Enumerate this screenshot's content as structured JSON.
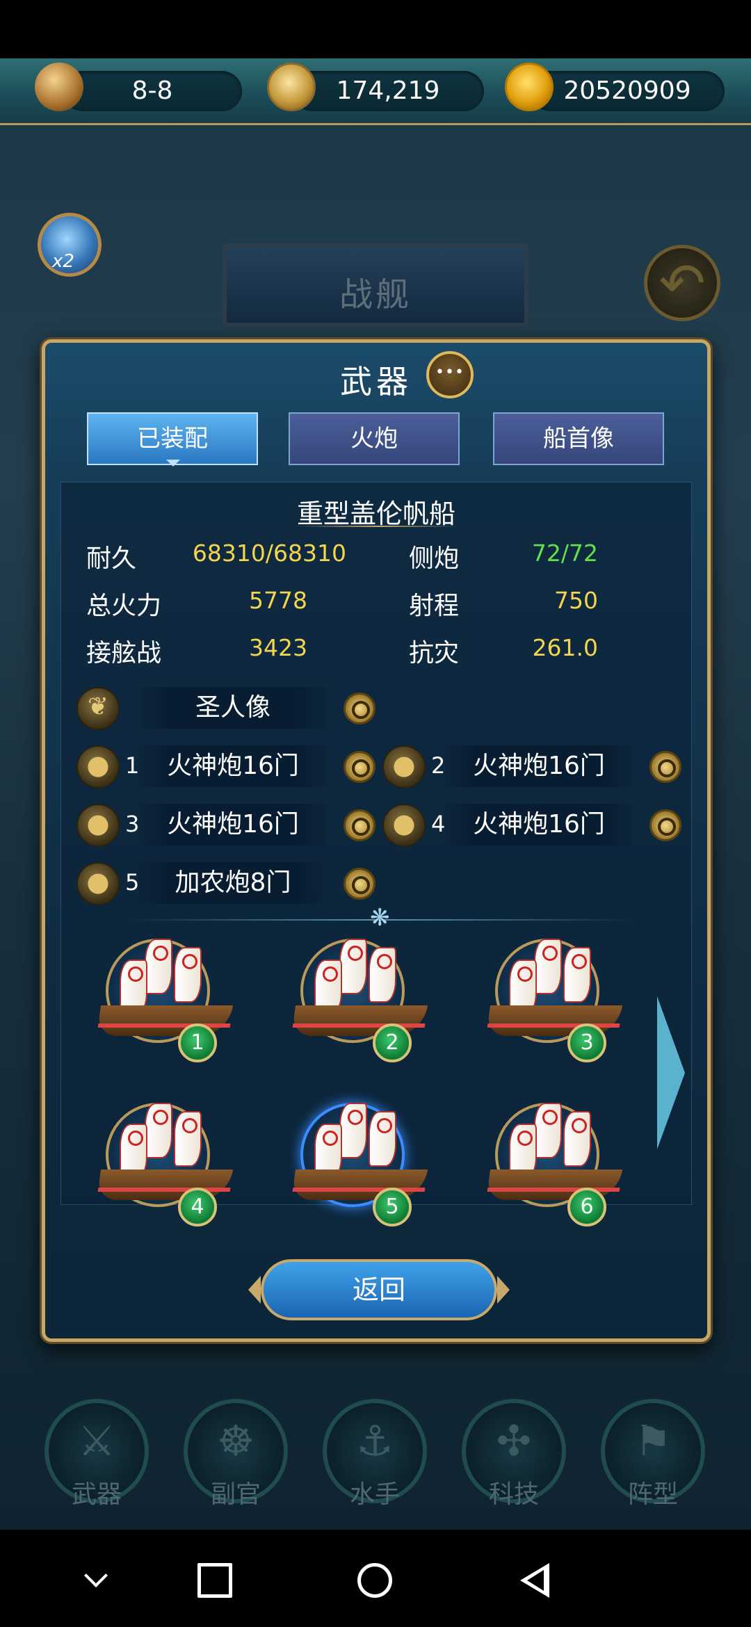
{
  "resources": {
    "stage": "8-8",
    "silver": "174,219",
    "gold": "20520909"
  },
  "scene": {
    "title": "战舰",
    "zoom_label": "x2"
  },
  "panel": {
    "title": "武器",
    "tabs": [
      {
        "label": "已装配",
        "active": true
      },
      {
        "label": "火炮",
        "active": false
      },
      {
        "label": "船首像",
        "active": false
      }
    ],
    "ship_name": "重型盖伦帆船",
    "stats": [
      {
        "label": "耐久",
        "value": "68310/68310"
      },
      {
        "label": "侧炮",
        "value": "72/72"
      },
      {
        "label": "总火力",
        "value": "5778"
      },
      {
        "label": "射程",
        "value": "750"
      },
      {
        "label": "接舷战",
        "value": "3423"
      },
      {
        "label": "抗灾",
        "value": "261.0"
      }
    ],
    "figurehead": {
      "name": "圣人像"
    },
    "cannons": [
      {
        "num": "1",
        "name": "火神炮16门"
      },
      {
        "num": "2",
        "name": "火神炮16门"
      },
      {
        "num": "3",
        "name": "火神炮16门"
      },
      {
        "num": "4",
        "name": "火神炮16门"
      },
      {
        "num": "5",
        "name": "加农炮8门"
      }
    ],
    "ships": [
      {
        "num": "1",
        "selected": false
      },
      {
        "num": "2",
        "selected": false
      },
      {
        "num": "3",
        "selected": false
      },
      {
        "num": "4",
        "selected": false
      },
      {
        "num": "5",
        "selected": true
      },
      {
        "num": "6",
        "selected": false
      }
    ],
    "return_label": "返回"
  },
  "bottom_menu": [
    {
      "label": "武器",
      "icon": "sword-icon"
    },
    {
      "label": "副官",
      "icon": "ship-wheel-icon"
    },
    {
      "label": "水手",
      "icon": "hook-icon"
    },
    {
      "label": "科技",
      "icon": "compass-icon"
    },
    {
      "label": "阵型",
      "icon": "flag-icon"
    }
  ],
  "colors": {
    "accent_gold": "#c8a766",
    "stat_yellow": "#f4d54d",
    "stat_green": "#63e04a",
    "tab_active": "#2a78c2"
  }
}
